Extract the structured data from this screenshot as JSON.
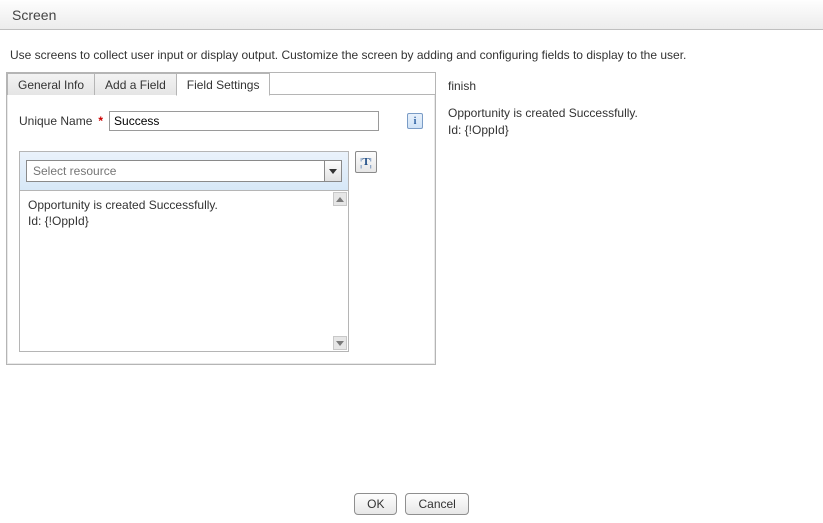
{
  "window": {
    "title": "Screen"
  },
  "description": "Use screens to collect user input or display output. Customize the screen by adding and configuring fields to display to the user.",
  "tabs": {
    "general_info": "General Info",
    "add_field": "Add a Field",
    "field_settings": "Field Settings"
  },
  "form": {
    "unique_name_label": "Unique Name",
    "required_marker": "*",
    "unique_name_value": "Success",
    "info_icon_glyph": "i"
  },
  "resource": {
    "placeholder": "Select resource",
    "text_tool_glyph_open": "¦",
    "text_tool_letter": "T",
    "text_tool_glyph_close": "¦",
    "body_line1": "Opportunity is created Successfully.",
    "body_line2": "Id: {!OppId}"
  },
  "preview": {
    "heading": "finish",
    "line1": "Opportunity is created Successfully.",
    "line2": "Id: {!OppId}"
  },
  "footer": {
    "ok": "OK",
    "cancel": "Cancel"
  }
}
